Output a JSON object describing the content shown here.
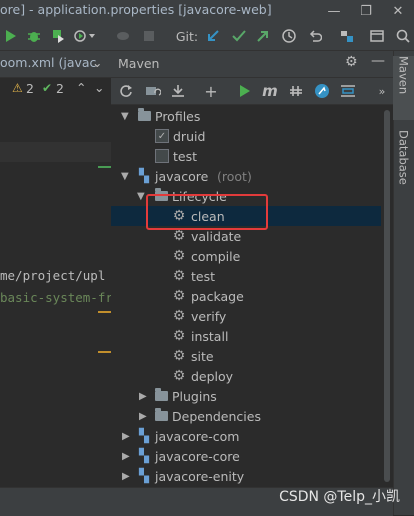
{
  "window": {
    "title": "ore] - application.properties [javacore-web]",
    "controls": [
      "—",
      "❐",
      "✕"
    ]
  },
  "toolbar": {
    "git_label": "Git:"
  },
  "editor": {
    "tab_label": "oom.xml (javac",
    "errors_count": "2",
    "warnings_count": "2",
    "code_lines": [
      "me/project/upl",
      "basic-system-fr"
    ]
  },
  "maven": {
    "title": "Maven",
    "tree": {
      "profiles": {
        "label": "Profiles",
        "items": [
          {
            "label": "druid",
            "checked": true
          },
          {
            "label": "test",
            "checked": false
          }
        ]
      },
      "root": {
        "name": "javacore",
        "suffix": "(root)",
        "lifecycle": {
          "label": "Lifecycle",
          "items": [
            "clean",
            "validate",
            "compile",
            "test",
            "package",
            "verify",
            "install",
            "site",
            "deploy"
          ]
        },
        "plugins_label": "Plugins",
        "dependencies_label": "Dependencies"
      },
      "modules": [
        "javacore-com",
        "javacore-core",
        "javacore-enity"
      ]
    }
  },
  "sidebar_right": {
    "maven_tab": "Maven",
    "database_tab": "Database"
  },
  "watermark": "CSDN @Telp_小凯",
  "colors": {
    "background": "#2b2b2b",
    "panel": "#3c3f41",
    "selection": "#0d293e",
    "run_green": "#4caf50",
    "highlight_box": "#e33b3b",
    "string_green": "#6a8759"
  }
}
